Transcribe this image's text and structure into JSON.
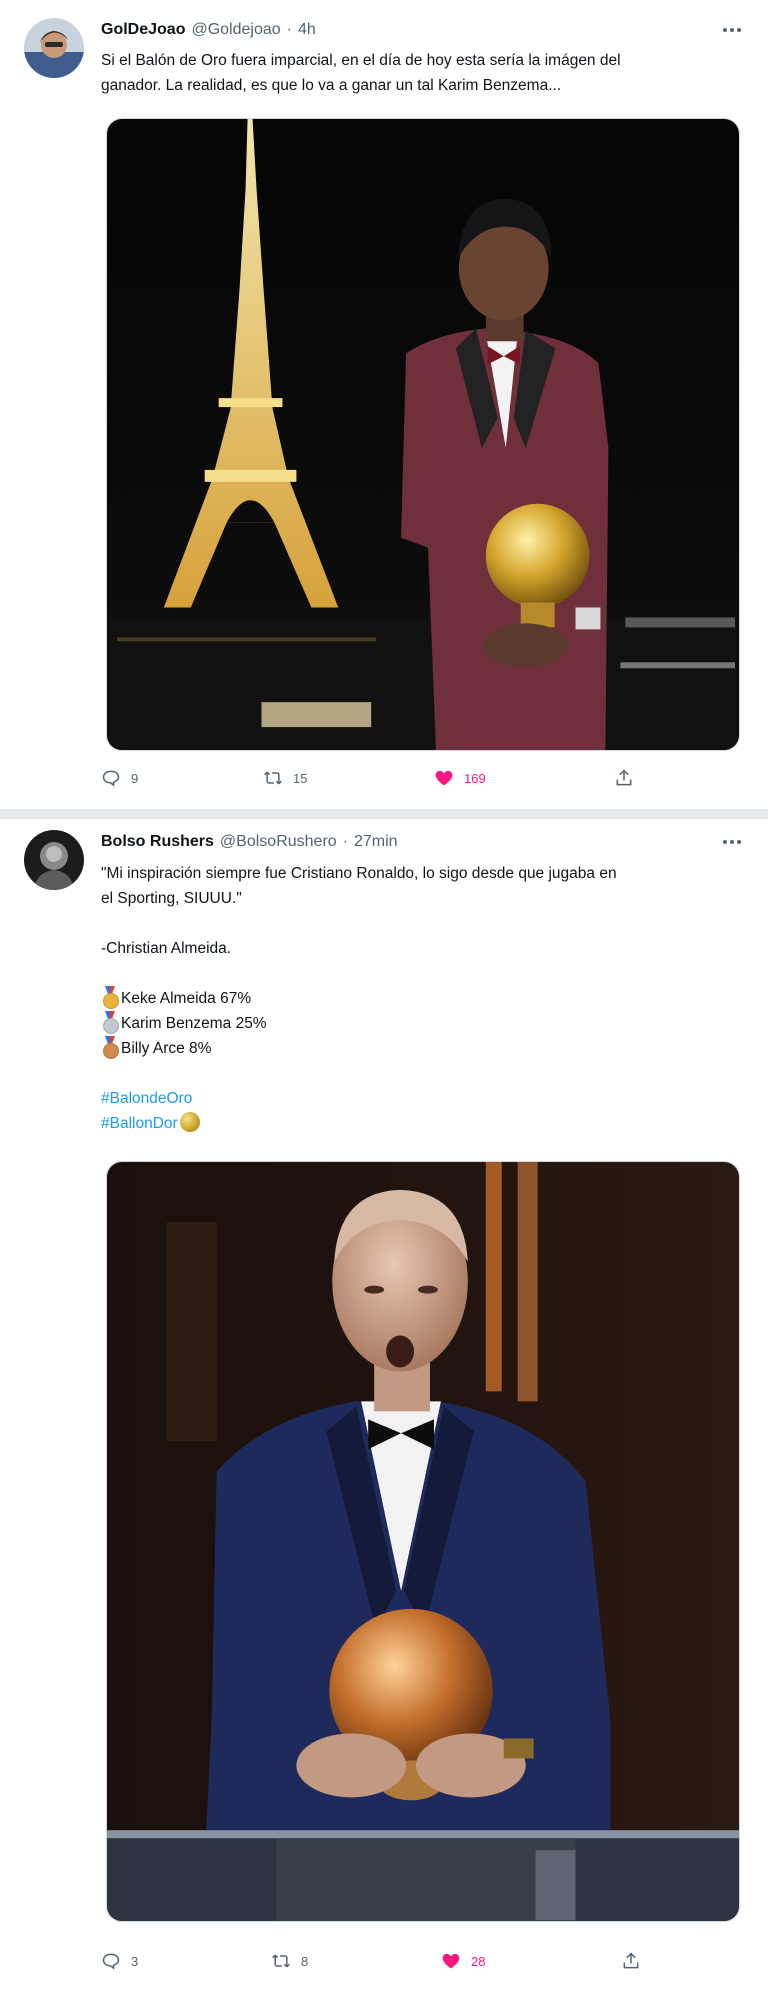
{
  "tweets": [
    {
      "author": {
        "name": "GolDeJoao",
        "handle": "@Goldejoao",
        "time": "4h"
      },
      "text": [
        "Si el Balón de Oro fuera imparcial, en el día de hoy esta sería la imágen del",
        "ganador. La realidad, es que lo va a ganar un tal Karim Benzema..."
      ],
      "media_alt": "Photo",
      "actions": {
        "reply_count": "9",
        "retweet_count": "15",
        "like_count": "169",
        "liked": true
      }
    },
    {
      "author": {
        "name": "Bolso Rushers",
        "handle": "@BolsoRushero",
        "time": "27min"
      },
      "text": {
        "quote_line1": "\"Mi inspiración siempre fue Cristiano Ronaldo, lo sigo desde que jugaba en",
        "quote_line2": "el Sporting, SIUUU.\"",
        "signature": "-Christian Almeida.",
        "rankings": [
          {
            "medal": "gold",
            "text": "Keke Almeida 67%"
          },
          {
            "medal": "silver",
            "text": "Karim Benzema 25%"
          },
          {
            "medal": "bronze",
            "text": "Billy Arce 8%"
          }
        ],
        "hashtags": [
          "#BalondeOro",
          "#BallonDor"
        ]
      },
      "media_alt": "Photo",
      "actions": {
        "reply_count": "3",
        "retweet_count": "8",
        "like_count": "28",
        "liked": true
      }
    }
  ],
  "colors": {
    "link": "#1d9bf0",
    "like": "#f91880",
    "secondary_text": "#536471"
  },
  "icons": [
    "more-icon",
    "reply-icon",
    "retweet-icon",
    "like-icon",
    "share-icon",
    "medal-icon",
    "ball-emoji-icon"
  ]
}
